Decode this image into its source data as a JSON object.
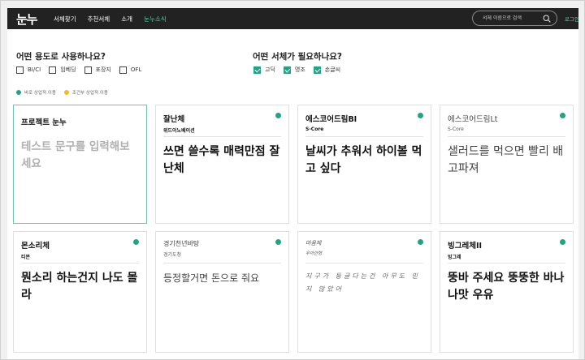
{
  "header": {
    "logo": "눈누",
    "nav": [
      {
        "label": "서체찾기",
        "active": false
      },
      {
        "label": "추천서체",
        "active": false
      },
      {
        "label": "소개",
        "active": false
      },
      {
        "label": "눈누소식",
        "active": true
      }
    ],
    "search_placeholder": "서체 이름으로 검색",
    "login": "로그인"
  },
  "filters": {
    "usage_question": "어떤 용도로 사용하나요?",
    "usage_options": [
      {
        "label": "BI/CI",
        "checked": false
      },
      {
        "label": "임베딩",
        "checked": false
      },
      {
        "label": "포장지",
        "checked": false
      },
      {
        "label": "OFL",
        "checked": false
      }
    ],
    "type_question": "어떤 서체가 필요하나요?",
    "type_options": [
      {
        "label": "고딕",
        "checked": true
      },
      {
        "label": "명조",
        "checked": true
      },
      {
        "label": "손글씨",
        "checked": true
      }
    ],
    "legend": [
      {
        "label": "바로 상업적 이용",
        "color": "#1fa586"
      },
      {
        "label": "조건부 상업적 이용",
        "color": "#f5b82e"
      }
    ]
  },
  "cards": [
    {
      "name": "프로젝트 눈누",
      "author": "",
      "sample": "테스트 문구를 입력해보세요",
      "dot": false
    },
    {
      "name": "잘난체",
      "author": "위드이노베이션",
      "sample": "쓰면 쓸수록 매력만점 잘난체",
      "dot": true
    },
    {
      "name": "에스코어드림BI",
      "author": "S-Core",
      "sample": "날씨가 추워서 하이볼 먹고 싶다",
      "dot": true
    },
    {
      "name": "에스코어드림Lt",
      "author": "S-Core",
      "sample": "샐러드를 먹으면 빨리 배고파져",
      "dot": true
    },
    {
      "name": "몬소리체",
      "author": "티몬",
      "sample": "뭔소리 하는건지 나도 몰라",
      "dot": true
    },
    {
      "name": "경기천년바탕",
      "author": "경기도청",
      "sample": "등정할거면 돈으로 줘요",
      "dot": true
    },
    {
      "name": "마음체",
      "author": "우아한형",
      "sample": "지구가 둥글다는건 아무도 믿지 않았어",
      "dot": true
    },
    {
      "name": "빙그레체II",
      "author": "빙그레",
      "sample": "뚱바 주세요 뚱뚱한 바나나맛 우유",
      "dot": true
    }
  ]
}
